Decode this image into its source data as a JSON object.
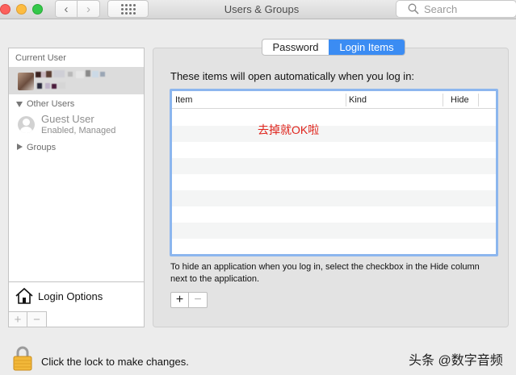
{
  "window": {
    "title": "Users & Groups",
    "search_placeholder": "Search"
  },
  "sidebar": {
    "current_user_label": "Current User",
    "other_users_label": "Other Users",
    "guest_user": {
      "name": "Guest User",
      "status": "Enabled, Managed"
    },
    "groups_label": "Groups",
    "login_options_label": "Login Options",
    "add_symbol": "+",
    "remove_symbol": "−"
  },
  "tabs": [
    {
      "label": "Password",
      "selected": false
    },
    {
      "label": "Login Items",
      "selected": true
    }
  ],
  "main": {
    "heading": "These items will open automatically when you log in:",
    "columns": [
      "Item",
      "Kind",
      "Hide"
    ],
    "rows": [],
    "annotation": "去掉就OK啦",
    "hint": "To hide an application when you log in, select the checkbox in the Hide column next to the application.",
    "add_symbol": "+",
    "remove_symbol": "−"
  },
  "footer": {
    "lock_text": "Click the lock to make changes."
  },
  "watermark": "头条 @数字音频",
  "colors": {
    "accent": "#3b8cf3",
    "annotation": "#e0231b",
    "table_focus": "#8cb6ee"
  }
}
